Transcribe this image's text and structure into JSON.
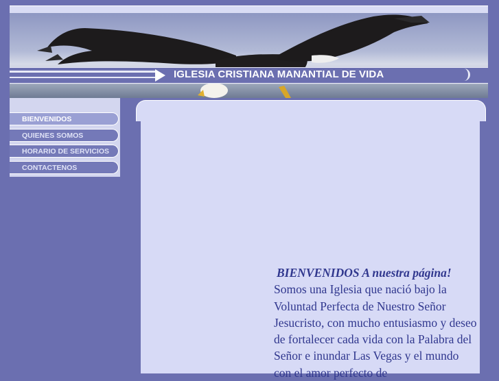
{
  "header": {
    "title": "IGLESIA CRISTIANA MANANTIAL DE VIDA"
  },
  "nav": {
    "items": [
      {
        "label": "BIENVENIDOS",
        "active": true
      },
      {
        "label": "QUIENES SOMOS",
        "active": false
      },
      {
        "label": "HORARIO DE SERVICIOS",
        "active": false
      },
      {
        "label": "CONTACTENOS",
        "active": false
      }
    ]
  },
  "main": {
    "heading": "BIENVENIDOS A nuestra página!",
    "body": "Somos una Iglesia que nació bajo la Voluntad Perfecta de Nuestro Señor Jesucristo, con mucho entusiasmo y deseo de fortalecer cada vida con la Palabra del Señor e inundar Las Vegas y el mundo con el amor perfecto de"
  },
  "colors": {
    "page_background": "#6b6fb0",
    "content_background": "#d7daf6",
    "text": "#30378e",
    "nav_active": "#9aa0d4"
  },
  "icons": {
    "banner_image": "eagle-icon",
    "title_arrow": "arrow-right-icon"
  }
}
